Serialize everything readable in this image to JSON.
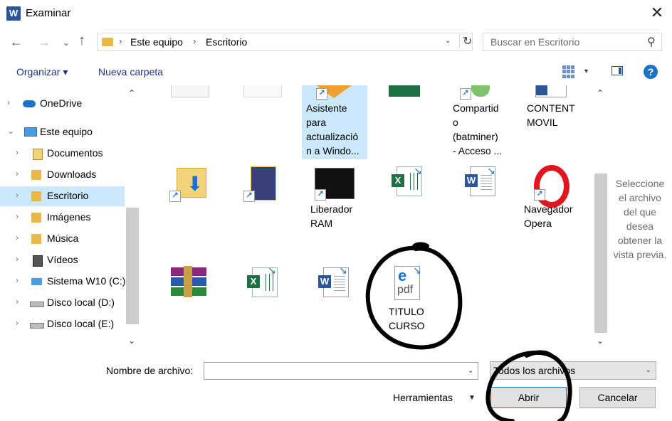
{
  "window": {
    "title": "Examinar",
    "app_icon": "W",
    "close": "✕"
  },
  "nav": {
    "back": "←",
    "forward": "→",
    "recent": "⌄",
    "up": "↑"
  },
  "address": {
    "sep": "›",
    "crumbs": [
      "Este equipo",
      "Escritorio"
    ],
    "dropdown": "⌄",
    "refresh": "↻"
  },
  "search": {
    "placeholder": "Buscar en Escritorio",
    "icon": "⚲"
  },
  "toolbar": {
    "organize": "Organizar ▾",
    "new_folder": "Nueva carpeta",
    "view_dd": "▾",
    "help": "?"
  },
  "sidebar": {
    "items": [
      {
        "label": "OneDrive",
        "chev": "›"
      },
      {
        "label": "Este equipo",
        "chev": "⌄"
      },
      {
        "label": "Documentos",
        "chev": "›"
      },
      {
        "label": "Downloads",
        "chev": "›"
      },
      {
        "label": "Escritorio",
        "chev": "›"
      },
      {
        "label": "Imágenes",
        "chev": "›"
      },
      {
        "label": "Música",
        "chev": "›"
      },
      {
        "label": "Vídeos",
        "chev": "›"
      },
      {
        "label": "Sistema W10 (C:)",
        "chev": "›"
      },
      {
        "label": "Disco local (D:)",
        "chev": "›"
      },
      {
        "label": "Disco local (E:)",
        "chev": "›"
      }
    ],
    "scroll_up": "⌃",
    "scroll_down": "⌄"
  },
  "files": [
    {
      "label": "Asistente\npara\nactualizació\nn a Windo..."
    },
    {
      "label": "Compartid\no\n(batminer)\n- Acceso ..."
    },
    {
      "label": "CONTENT\nMOVIL"
    },
    {
      "label": "Liberador\nRAM"
    },
    {
      "label": "Navegador\nOpera"
    },
    {
      "label": "TITULO\nCURSO"
    }
  ],
  "icons": {
    "xls_badge": "X",
    "doc_badge": "W",
    "shortcut": "↗",
    "pdf_e": "e",
    "pdf": "pdf"
  },
  "main_scroll": {
    "up": "⌃",
    "down": "⌄"
  },
  "preview_text": "Seleccione el archivo del que desea obtener la vista previa.",
  "bottom": {
    "filename_label": "Nombre de archivo:",
    "filename_value": "",
    "filter": "Todos los archivos",
    "tools": "Herramientas",
    "tools_dd": "▼",
    "dd": "⌄",
    "open": "Abrir",
    "cancel": "Cancelar"
  },
  "colors": {
    "accent": "#0078d7",
    "selected": "#cce8ff",
    "link": "#1e3287",
    "annotation": "#000000"
  }
}
